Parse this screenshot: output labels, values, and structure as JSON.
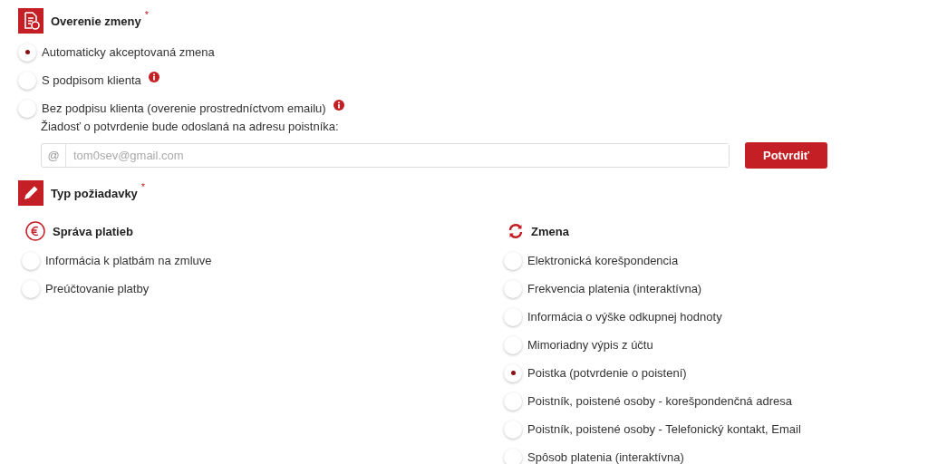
{
  "verification": {
    "title": "Overenie zmeny",
    "required": "*",
    "options": [
      {
        "label": "Automaticky akceptovaná zmena",
        "selected": true,
        "info": false
      },
      {
        "label": "S podpisom klienta",
        "selected": false,
        "info": true
      },
      {
        "label": "Bez podpisu klienta (overenie prostredníctvom emailu)",
        "selected": false,
        "info": true
      }
    ],
    "note": "Žiadosť o potvrdenie bude odoslaná na adresu poistníka:",
    "email": {
      "prefix": "@",
      "placeholder": "tom0sev@gmail.com"
    },
    "confirm_button": "Potvrdiť"
  },
  "request_type": {
    "title": "Typ požiadavky",
    "required": "*",
    "groups": [
      {
        "kind": "payment",
        "title": "Správa platieb",
        "options": [
          {
            "label": "Informácia k platbám na zmluve",
            "selected": false
          },
          {
            "label": "Preúčtovanie platby",
            "selected": false
          }
        ]
      },
      {
        "kind": "change",
        "title": "Zmena",
        "options": [
          {
            "label": "Elektronická korešpondencia",
            "selected": false
          },
          {
            "label": "Frekvencia platenia (interaktívna)",
            "selected": false
          },
          {
            "label": "Informácia o výške odkupnej hodnoty",
            "selected": false
          },
          {
            "label": "Mimoriadny výpis z účtu",
            "selected": false
          },
          {
            "label": "Poistka (potvrdenie o poistení)",
            "selected": true
          },
          {
            "label": "Poistník, poistené osoby - korešpondenčná adresa",
            "selected": false
          },
          {
            "label": "Poistník, poistené osoby - Telefonický kontakt, Email",
            "selected": false
          },
          {
            "label": "Spôsob platenia (interaktívna)",
            "selected": false
          }
        ]
      }
    ]
  }
}
